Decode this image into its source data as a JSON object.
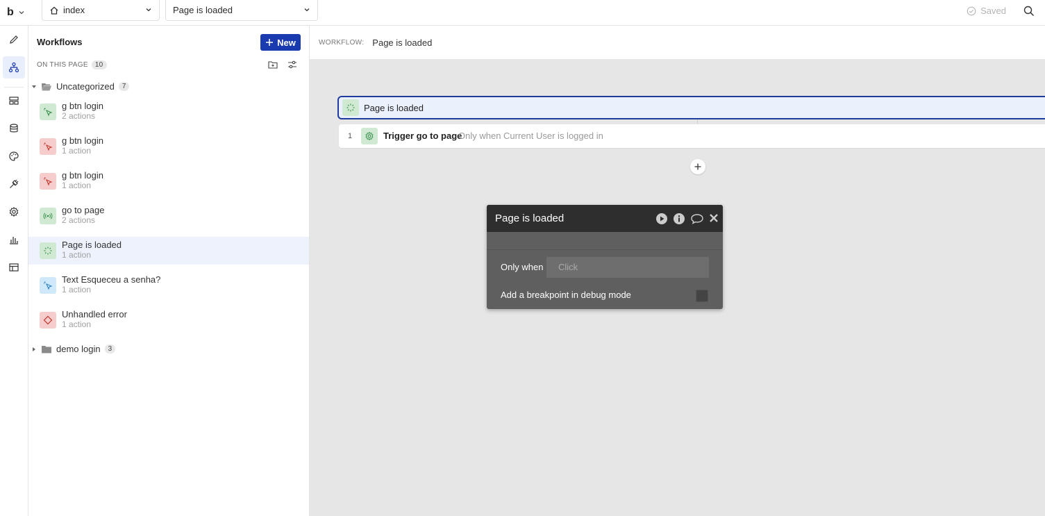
{
  "topbar": {
    "logo": "b",
    "page_dropdown": "index",
    "workflow_dropdown": "Page is loaded",
    "saved_label": "Saved"
  },
  "panel": {
    "title": "Workflows",
    "new_label": "New",
    "on_this_page_label": "ON THIS PAGE",
    "on_this_page_count": "10",
    "folders": [
      {
        "name": "Uncategorized",
        "count": "7",
        "expanded": true
      },
      {
        "name": "demo login",
        "count": "3",
        "expanded": false
      }
    ],
    "items": [
      {
        "name": "g btn login",
        "sub": "2 actions",
        "color": "green",
        "icon": "cursor-click-icon"
      },
      {
        "name": "g btn login",
        "sub": "1 action",
        "color": "red",
        "icon": "cursor-click-icon"
      },
      {
        "name": "g btn login",
        "sub": "1 action",
        "color": "red",
        "icon": "cursor-click-icon"
      },
      {
        "name": "go to page",
        "sub": "2 actions",
        "color": "green",
        "icon": "broadcast-icon"
      },
      {
        "name": "Page is loaded",
        "sub": "1 action",
        "color": "green",
        "icon": "loading-spinner-icon",
        "selected": true
      },
      {
        "name": "Text Esqueceu a senha?",
        "sub": "1 action",
        "color": "blue",
        "icon": "cursor-click-icon"
      },
      {
        "name": "Unhandled error",
        "sub": "1 action",
        "color": "red",
        "icon": "error-diamond-icon"
      }
    ]
  },
  "canvas": {
    "header_label": "WORKFLOW:",
    "header_value": "Page is loaded",
    "event_title": "Page is loaded",
    "action": {
      "number": "1",
      "title": "Trigger go to page",
      "condition": "Only when Current User is logged in"
    }
  },
  "popup": {
    "title": "Page is loaded",
    "only_when_label": "Only when",
    "only_when_placeholder": "Click",
    "breakpoint_label": "Add a breakpoint in debug mode"
  },
  "colors": {
    "accent": "#1a3ab0",
    "green_icon_bg": "#cfe9d2",
    "red_icon_bg": "#f7cccc",
    "blue_icon_bg": "#cfe9fb"
  }
}
